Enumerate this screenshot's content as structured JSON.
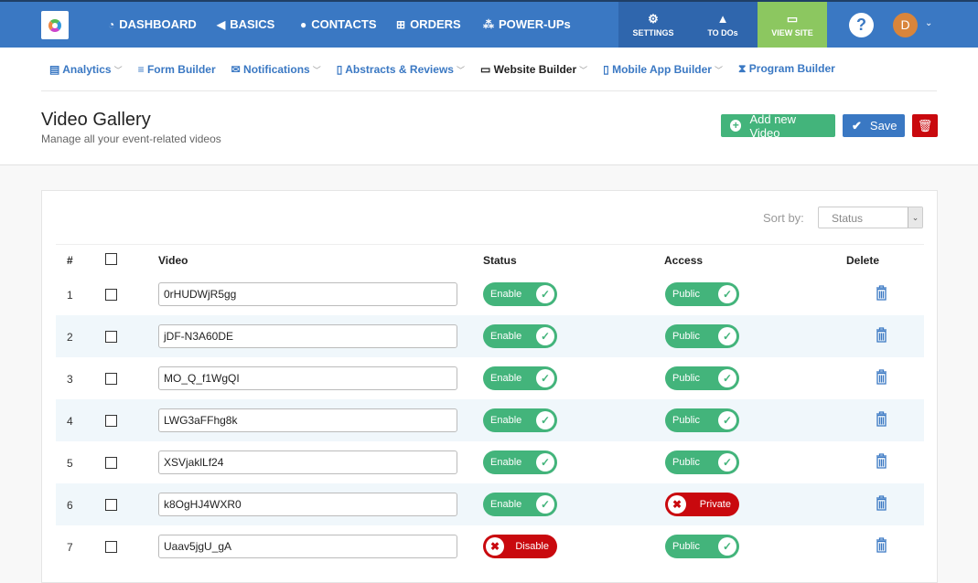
{
  "topnav": {
    "items": [
      {
        "label": "DASHBOARD",
        "icon": "dashboard-icon"
      },
      {
        "label": "BASICS",
        "icon": "megaphone-icon"
      },
      {
        "label": "CONTACTS",
        "icon": "user-icon"
      },
      {
        "label": "ORDERS",
        "icon": "cart-icon"
      },
      {
        "label": "POWER-UPs",
        "icon": "cubes-icon"
      }
    ],
    "settings": "SETTINGS",
    "todos": "TO DOs",
    "view_site": "VIEW SITE",
    "help": "?",
    "avatar": "D"
  },
  "subnav": [
    {
      "label": "Analytics",
      "dropdown": true
    },
    {
      "label": "Form Builder",
      "dropdown": false
    },
    {
      "label": "Notifications",
      "dropdown": true
    },
    {
      "label": "Abstracts & Reviews",
      "dropdown": true
    },
    {
      "label": "Website Builder",
      "dropdown": true,
      "active": true
    },
    {
      "label": "Mobile App Builder",
      "dropdown": true
    },
    {
      "label": "Program Builder",
      "dropdown": false
    }
  ],
  "page": {
    "title": "Video Gallery",
    "subtitle": "Manage all your event-related videos",
    "add_label": "Add new Video",
    "save_label": "Save"
  },
  "sort": {
    "label": "Sort by:",
    "value": "Status"
  },
  "table": {
    "headers": {
      "num": "#",
      "video": "Video",
      "status": "Status",
      "access": "Access",
      "delete": "Delete"
    },
    "rows": [
      {
        "n": "1",
        "video": "0rHUDWjR5gg",
        "status": "Enable",
        "access": "Public"
      },
      {
        "n": "2",
        "video": "jDF-N3A60DE",
        "status": "Enable",
        "access": "Public"
      },
      {
        "n": "3",
        "video": "MO_Q_f1WgQI",
        "status": "Enable",
        "access": "Public"
      },
      {
        "n": "4",
        "video": "LWG3aFFhg8k",
        "status": "Enable",
        "access": "Public"
      },
      {
        "n": "5",
        "video": "XSVjaklLf24",
        "status": "Enable",
        "access": "Public"
      },
      {
        "n": "6",
        "video": "k8OgHJ4WXR0",
        "status": "Enable",
        "access": "Private"
      },
      {
        "n": "7",
        "video": "Uaav5jgU_gA",
        "status": "Disable",
        "access": "Public"
      }
    ]
  },
  "colors": {
    "brand": "#3a78c3",
    "success": "#43b47b",
    "danger": "#c9090e",
    "view_site": "#8cc760"
  }
}
